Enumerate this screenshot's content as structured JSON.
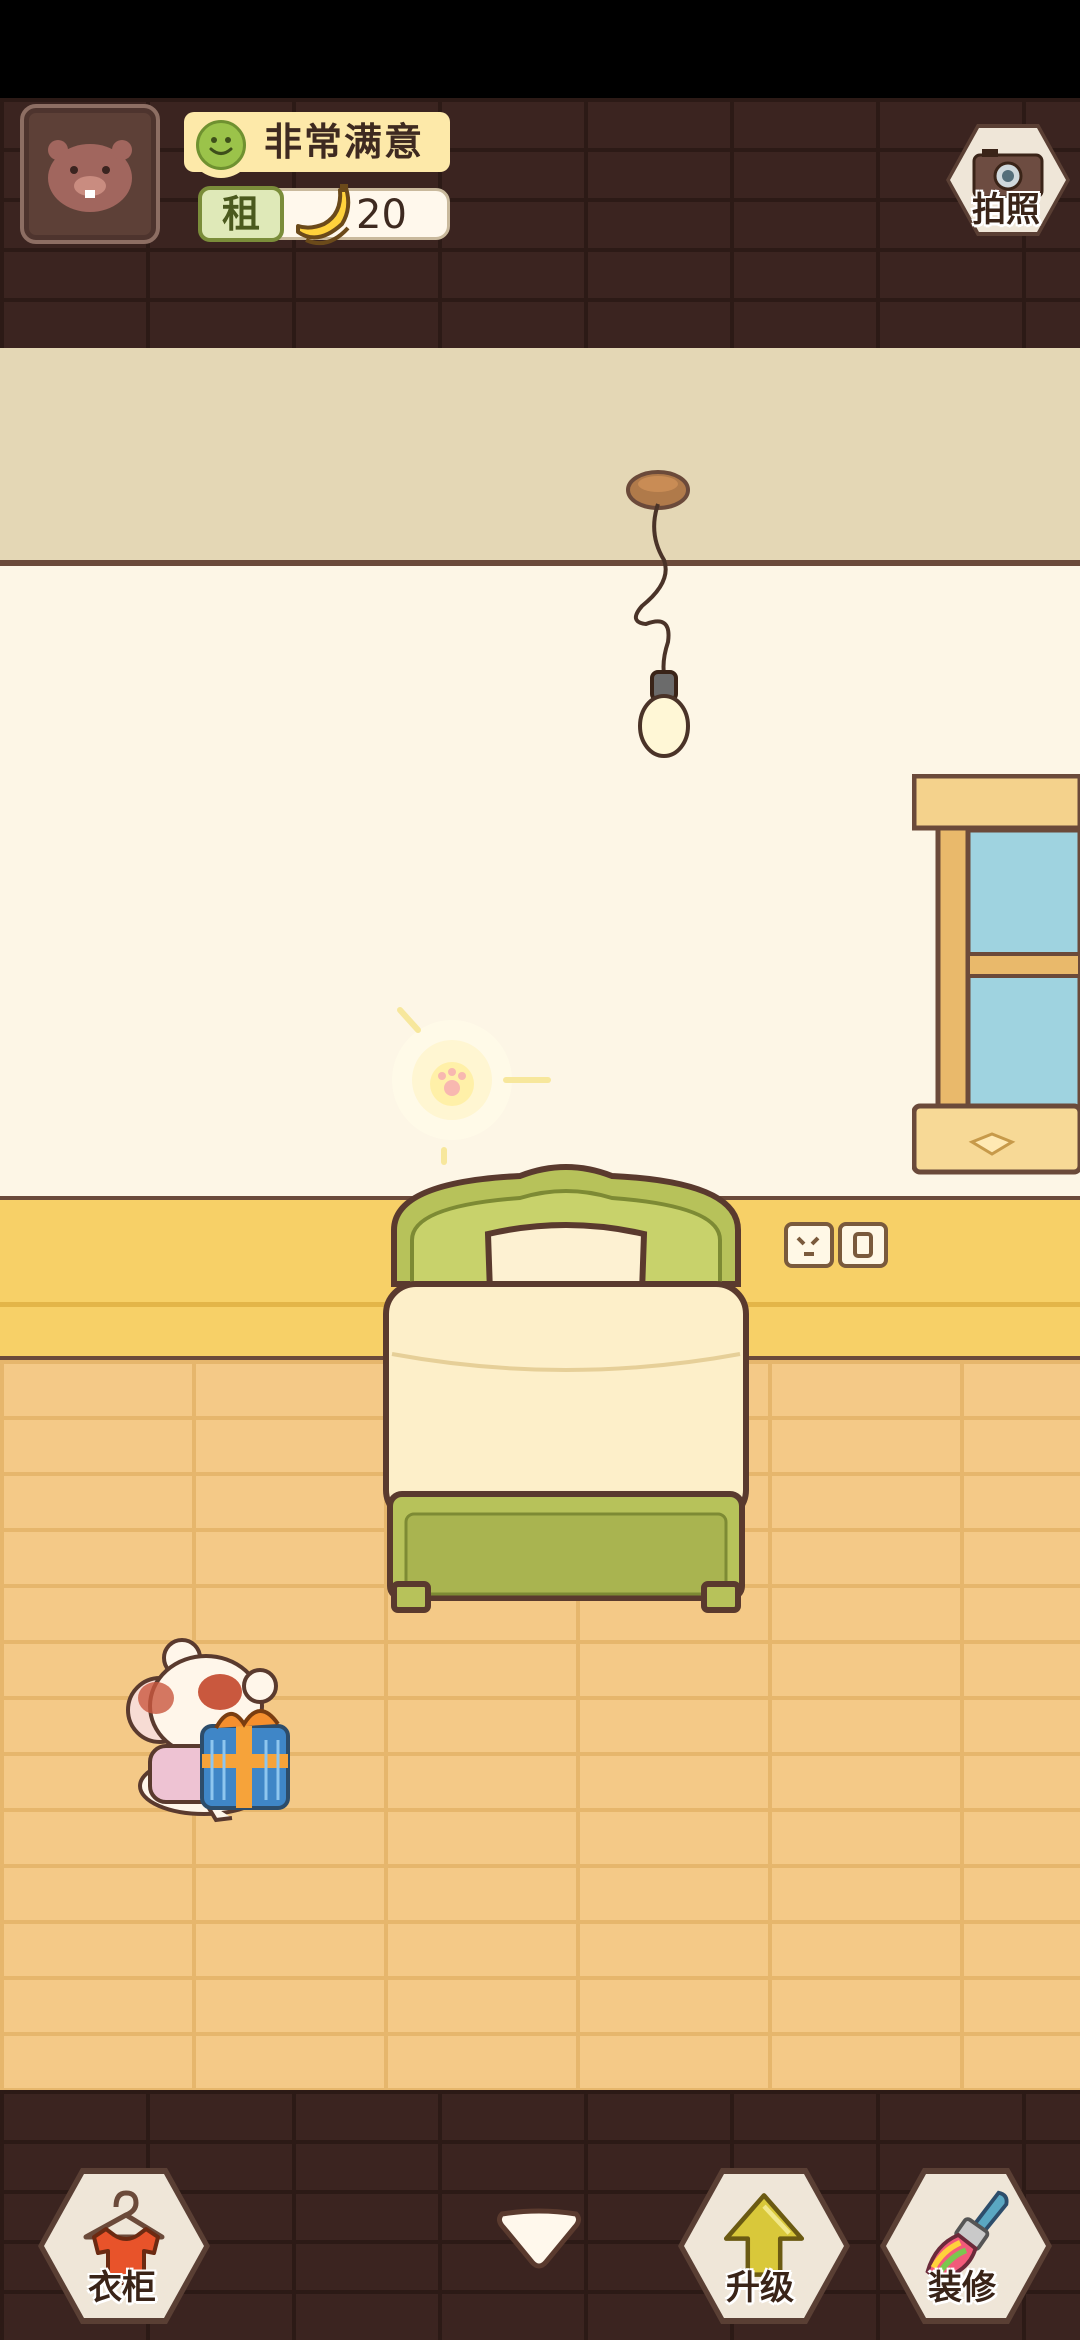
{
  "hud": {
    "satisfaction": "非常满意",
    "rent_label": "租",
    "rent_value": "20"
  },
  "top_actions": {
    "photo_label": "拍照"
  },
  "bottom_bar": {
    "wardrobe_label": "衣柜",
    "upgrade_label": "升级",
    "decorate_label": "装修"
  },
  "icons": {
    "avatar": "beaver-face-icon",
    "satisfaction": "smile-icon",
    "rent_currency": "banana-icon",
    "photo": "camera-icon",
    "wardrobe": "shirt-hanger-icon",
    "upgrade": "arrow-up-icon",
    "decorate": "paint-brush-icon",
    "collapse": "chevron-down-icon"
  },
  "colors": {
    "brick": "#3b2420",
    "wall": "#fdf6e6",
    "ceiling": "#e4d7b5",
    "wainscot": "#f7d067",
    "floor": "#f4c987",
    "bed_green": "#b7c25a",
    "accent_text": "#3e2a20"
  }
}
